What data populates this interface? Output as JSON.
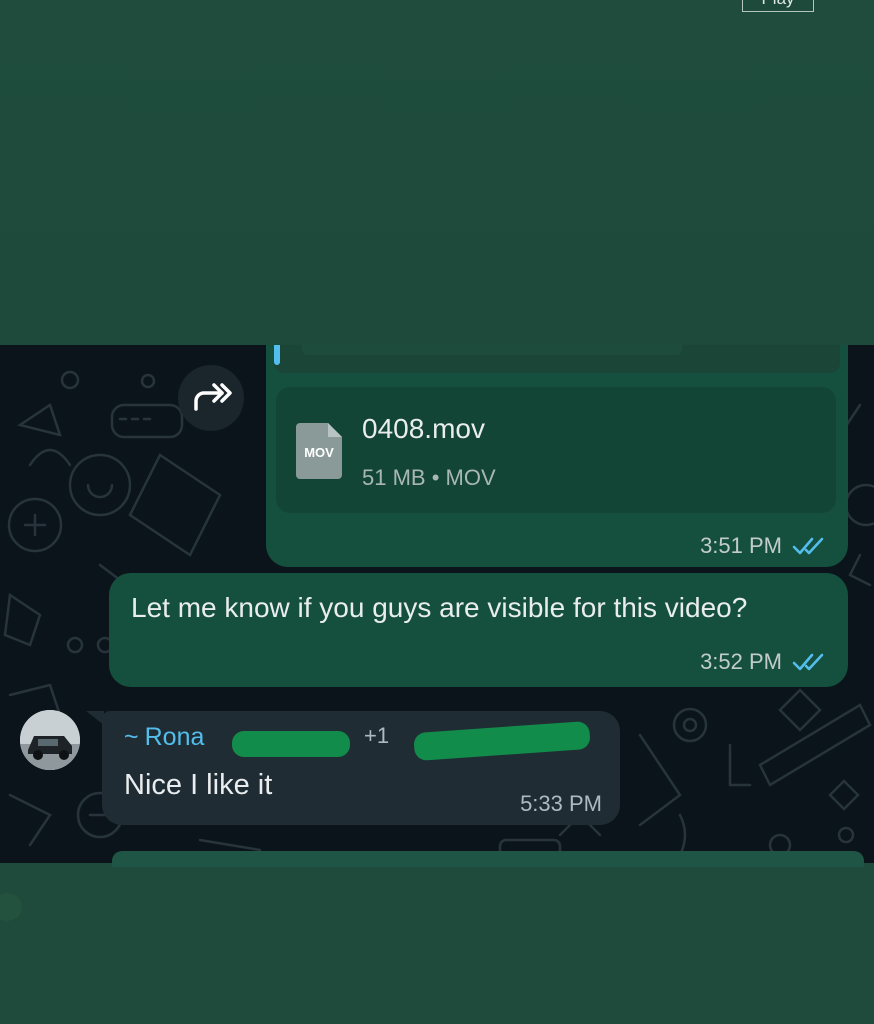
{
  "top_overlay": {
    "play_label": "Play"
  },
  "messages": {
    "file_message": {
      "file_type_badge": "MOV",
      "file_name": "0408.mov",
      "file_meta": "51 MB • MOV",
      "time": "3:51 PM",
      "status_icon": "double-check-icon"
    },
    "text_message": {
      "text": "Let me know if you guys are visible for this video?",
      "time": "3:52 PM",
      "status_icon": "double-check-icon"
    },
    "incoming_message": {
      "sender_prefix": "~",
      "sender_name": "Rona",
      "sender_phone": "+1",
      "text": "Nice I like it",
      "time": "5:33 PM"
    }
  },
  "colors": {
    "outgoing_bubble": "#15503f",
    "incoming_bubble": "#202c33",
    "chat_background": "#0b141a",
    "overlay_green": "#1e4b3c",
    "sender_name": "#53bdeb",
    "read_tick": "#53bdeb",
    "redaction": "#128c4a"
  }
}
